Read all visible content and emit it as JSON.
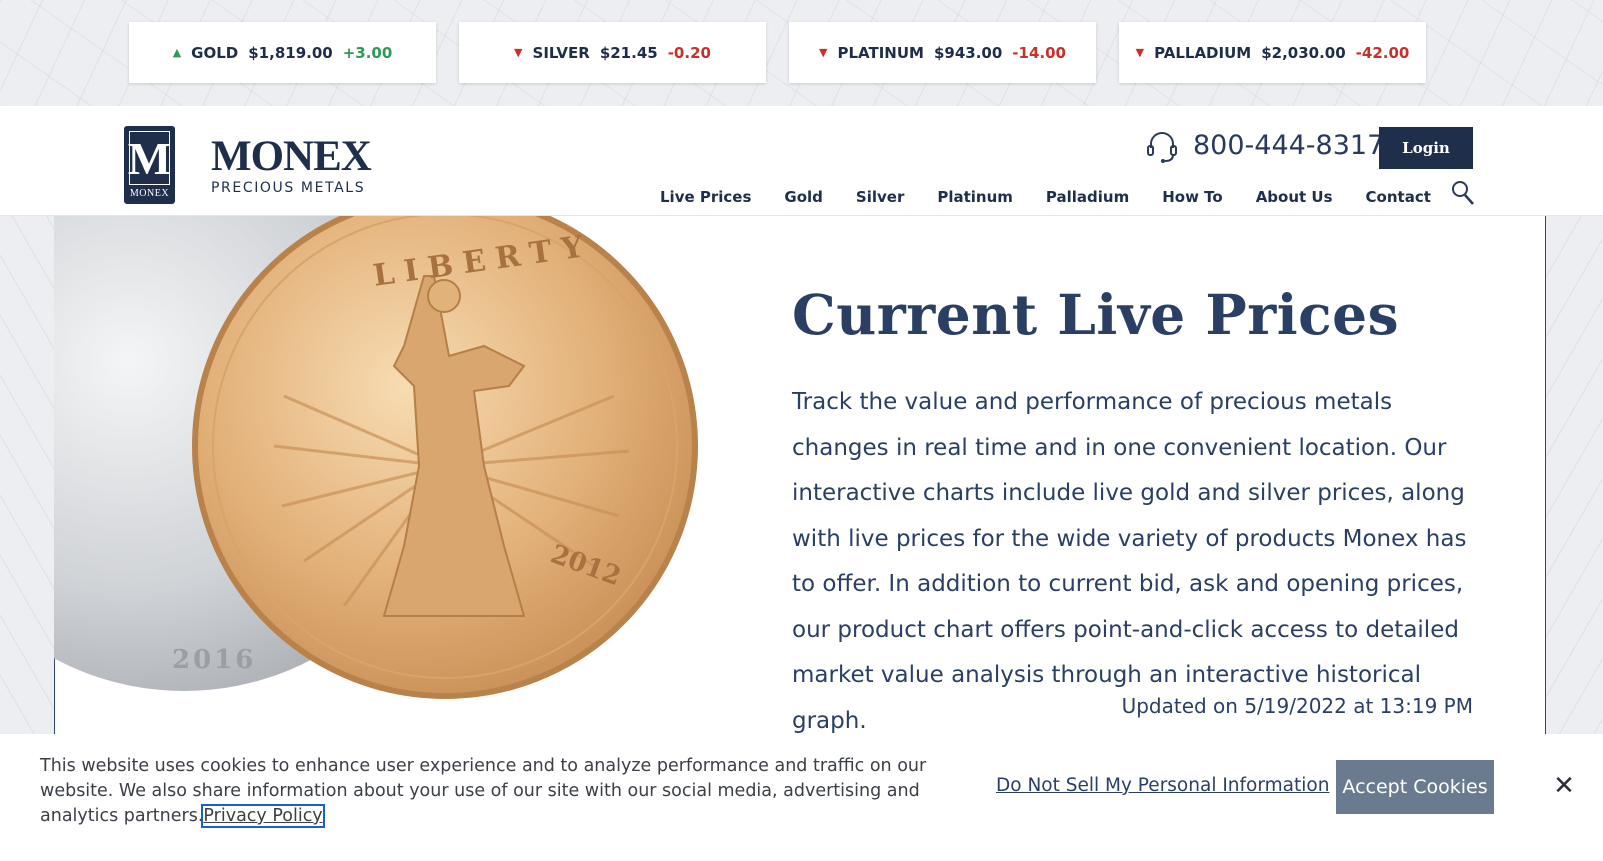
{
  "tickers": [
    {
      "direction": "up",
      "metal": "GOLD",
      "price": "$1,819.00",
      "change": "+3.00"
    },
    {
      "direction": "down",
      "metal": "SILVER",
      "price": "$21.45",
      "change": "-0.20"
    },
    {
      "direction": "down",
      "metal": "PLATINUM",
      "price": "$943.00",
      "change": "-14.00"
    },
    {
      "direction": "down",
      "metal": "PALLADIUM",
      "price": "$2,030.00",
      "change": "-42.00"
    }
  ],
  "header": {
    "logo_letter": "M",
    "logo_small": "MONEX",
    "brand_name": "MONEX",
    "brand_sub": "PRECIOUS METALS",
    "phone": "800-444-8317",
    "login_label": "Login"
  },
  "nav": [
    "Live Prices",
    "Gold",
    "Silver",
    "Platinum",
    "Palladium",
    "How To",
    "About Us",
    "Contact"
  ],
  "hero": {
    "title": "Current Live Prices",
    "description": "Track the value and performance of precious metals changes in real time and in one convenient location. Our interactive charts include live gold and silver prices, along with live prices for the wide variety of products Monex has to offer. In addition to current bid, ask and opening prices, our product chart offers point-and-click access to detailed market value analysis through an interactive historical graph.",
    "updated": "Updated on 5/19/2022 at 13:19 PM",
    "coin_gold_word": "LIBERTY",
    "coin_gold_year": "2012",
    "coin_silver_year": "2016"
  },
  "cookie": {
    "text": "This website uses cookies to enhance user experience and to analyze performance and traffic on our website. We also share information about your use of our site with our social media, advertising and analytics partners.",
    "privacy_label": "Privacy Policy",
    "do_not_sell_label": "Do Not Sell My Personal Information",
    "accept_label": "Accept Cookies",
    "close_glyph": "✕"
  },
  "colors": {
    "navy": "#1f2e4b",
    "up": "#2e9a58",
    "down": "#c8302b",
    "accept_bg": "#6a7b8f"
  }
}
